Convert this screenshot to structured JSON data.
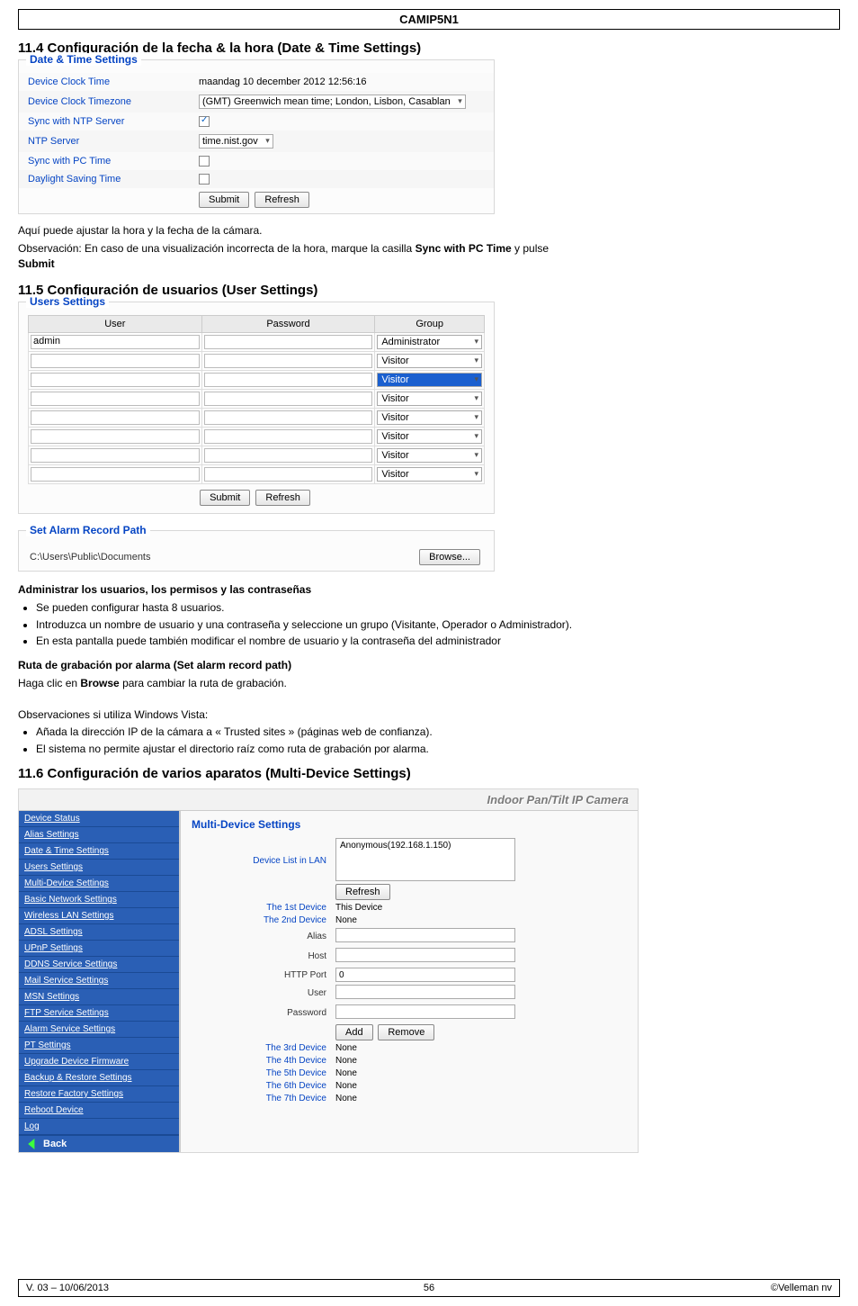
{
  "page": {
    "header": "CAMIP5N1",
    "footer": {
      "left": "V. 03 – 10/06/2013",
      "center": "56",
      "right": "©Velleman nv"
    }
  },
  "sec114": {
    "title": "11.4   Configuración de la fecha & la hora (Date & Time Settings)",
    "legend": "Date & Time Settings",
    "rows": {
      "r1": {
        "label": "Device Clock Time",
        "value": "maandag 10 december 2012 12:56:16"
      },
      "r2": {
        "label": "Device Clock Timezone",
        "value": "(GMT) Greenwich mean time; London, Lisbon, Casablan"
      },
      "r3": {
        "label": "Sync with NTP Server"
      },
      "r4": {
        "label": "NTP Server",
        "value": "time.nist.gov"
      },
      "r5": {
        "label": "Sync with PC Time"
      },
      "r6": {
        "label": "Daylight Saving Time"
      }
    },
    "buttons": {
      "submit": "Submit",
      "refresh": "Refresh"
    },
    "note1": "Aquí puede ajustar la hora y la fecha de la cámara.",
    "note2a": "Observación: En caso de una visualización incorrecta de la hora, marque la casilla ",
    "note2b": "Sync with PC Time",
    "note2c": " y pulse ",
    "note2d": "Submit"
  },
  "sec115": {
    "title": "11.5   Configuración de usuarios (User Settings)",
    "legend": "Users Settings",
    "headers": {
      "user": "User",
      "password": "Password",
      "group": "Group"
    },
    "admin_user": "admin",
    "groups": {
      "admin": "Administrator",
      "visitor": "Visitor"
    },
    "buttons": {
      "submit": "Submit",
      "refresh": "Refresh",
      "browse": "Browse..."
    },
    "record_legend": "Set Alarm Record Path",
    "record_path": "C:\\Users\\Public\\Documents",
    "admin_title": "Administrar los usuarios, los permisos y las contraseñas",
    "bul1": "Se pueden configurar hasta 8 usuarios.",
    "bul2": "Introduzca un nombre de usuario y una contraseña y seleccione un grupo (Visitante, Operador o Administrador).",
    "bul3": "En esta pantalla puede también modificar el nombre de usuario y la contraseña del administrador",
    "route_title": "Ruta de grabación por alarma (Set alarm record path)",
    "route_text_a": "Haga clic en ",
    "route_text_b": "Browse",
    "route_text_c": " para cambiar la ruta de grabación.",
    "obs_title": "Observaciones si utiliza Windows Vista:",
    "obs1": "Añada la dirección IP de la cámara a « Trusted sites »  (páginas web de confianza).",
    "obs2": "El sistema no permite ajustar el directorio raíz como ruta de grabación por alarma."
  },
  "sec116": {
    "title": "11.6   Configuración de varios aparatos (Multi-Device Settings)",
    "banner": "Indoor Pan/Tilt IP Camera",
    "sidebar": [
      "Device Status",
      "Alias Settings",
      "Date & Time Settings",
      "Users Settings",
      "Multi-Device Settings",
      "Basic Network Settings",
      "Wireless LAN Settings",
      "ADSL Settings",
      "UPnP Settings",
      "DDNS Service Settings",
      "Mail Service Settings",
      "MSN Settings",
      "FTP Service Settings",
      "Alarm Service Settings",
      "PT Settings",
      "Upgrade Device Firmware",
      "Backup & Restore Settings",
      "Restore Factory Settings",
      "Reboot Device",
      "Log"
    ],
    "back": "Back",
    "main": {
      "legend": "Multi-Device Settings",
      "lan_label": "Device List in LAN",
      "lan_device": "Anonymous(192.168.1.150)",
      "refresh": "Refresh",
      "d1_label": "The 1st Device",
      "d1_val": "This Device",
      "d2_label": "The 2nd Device",
      "d2_val": "None",
      "alias": "Alias",
      "host": "Host",
      "http_port": "HTTP Port",
      "http_port_val": "0",
      "user": "User",
      "password": "Password",
      "add": "Add",
      "remove": "Remove",
      "d3": {
        "label": "The 3rd Device",
        "val": "None"
      },
      "d4": {
        "label": "The 4th Device",
        "val": "None"
      },
      "d5": {
        "label": "The 5th Device",
        "val": "None"
      },
      "d6": {
        "label": "The 6th Device",
        "val": "None"
      },
      "d7": {
        "label": "The 7th Device",
        "val": "None"
      }
    }
  }
}
